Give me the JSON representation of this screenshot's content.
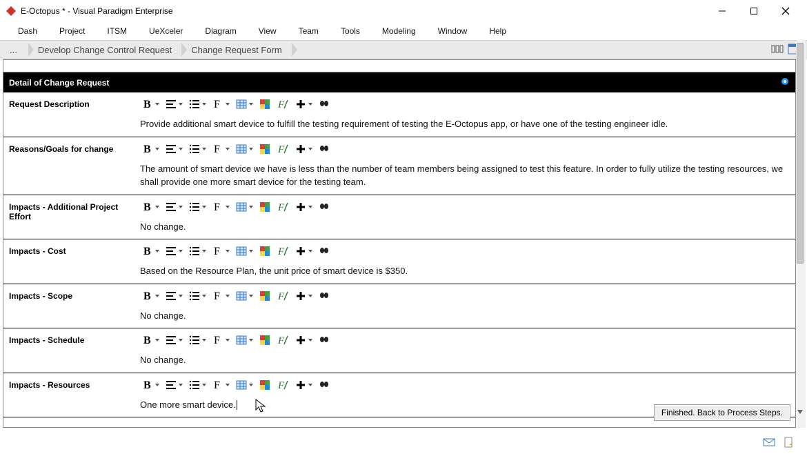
{
  "window": {
    "title": "E-Octopus * - Visual Paradigm Enterprise"
  },
  "menu": {
    "items": [
      "Dash",
      "Project",
      "ITSM",
      "UeXceler",
      "Diagram",
      "View",
      "Team",
      "Tools",
      "Modeling",
      "Window",
      "Help"
    ]
  },
  "breadcrumb": {
    "ellipsis": "...",
    "item1": "Develop Change Control Request",
    "item2": "Change Request Form"
  },
  "panel": {
    "header": "Detail of Change Request"
  },
  "fields": [
    {
      "label": "Request Description",
      "text": "Provide additional smart device to fulfill the testing requirement of testing the E-Octopus app, or have one of the testing engineer idle."
    },
    {
      "label": "Reasons/Goals for change",
      "text": "The amount of smart device we have is less than the number of team members being assigned to test this feature. In order to fully utilize the testing resources, we shall provide one more smart device for the testing team."
    },
    {
      "label": "Impacts - Additional Project Effort",
      "text": "No change."
    },
    {
      "label": "Impacts - Cost",
      "text": "Based on the Resource Plan, the unit price of smart device is $350."
    },
    {
      "label": "Impacts - Scope",
      "text": "No change."
    },
    {
      "label": "Impacts - Schedule",
      "text": "No change."
    },
    {
      "label": "Impacts - Resources",
      "text": "One more smart device."
    }
  ],
  "buttons": {
    "finished": "Finished. Back to Process Steps."
  },
  "rich_text_toolbar_icons": [
    "bold",
    "align",
    "list",
    "font",
    "table",
    "shape-color",
    "shape-style",
    "insert",
    "find"
  ]
}
